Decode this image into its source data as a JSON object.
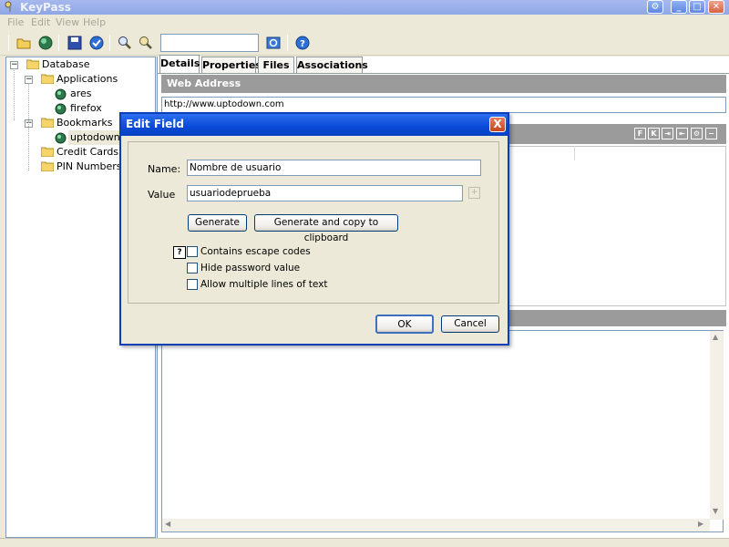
{
  "app": {
    "title": "KeyPass",
    "window_controls": [
      "help",
      "minimize",
      "maximize",
      "close"
    ]
  },
  "menu": [
    "File",
    "Edit",
    "View",
    "Help"
  ],
  "toolbar": {
    "icons": [
      "open-folder-icon",
      "globe-icon",
      "save-icon",
      "check-icon",
      "search-icon",
      "find-key-icon",
      "refresh-icon",
      "help-icon"
    ],
    "search_value": ""
  },
  "tree": {
    "root": "Database",
    "items": [
      {
        "label": "Applications",
        "children": [
          "ares",
          "firefox"
        ]
      },
      {
        "label": "Bookmarks",
        "children": [
          "uptodown"
        ]
      },
      {
        "label": "Credit Cards",
        "children": []
      },
      {
        "label": "PIN Numbers",
        "children": []
      }
    ],
    "selected": "uptodown"
  },
  "tabs": [
    "Details",
    "Properties",
    "Files",
    "Associations"
  ],
  "details": {
    "section_title": "Web Address",
    "url": "http://www.uptodown.com",
    "field_buttons": [
      "F",
      "K",
      "in",
      "out",
      "gear",
      "minus"
    ]
  },
  "dialog": {
    "title": "Edit Field",
    "name_label": "Name:",
    "name_value": "Nombre de usuario",
    "value_label": "Value",
    "value_value": "usuariodeprueba",
    "generate_label": "Generate",
    "generate_copy_label": "Generate and copy to clipboard",
    "help_label": "?",
    "checkboxes": [
      {
        "label": "Contains escape codes",
        "checked": false
      },
      {
        "label": "Hide password value",
        "checked": false
      },
      {
        "label": "Allow multiple lines of text",
        "checked": false
      }
    ],
    "ok_label": "OK",
    "cancel_label": "Cancel",
    "close_label": "X",
    "plus_label": "+"
  },
  "colors": {
    "dialog_title": "#0a49d6",
    "section_header": "#9b9b9b",
    "window_bg": "#ece9d8"
  }
}
